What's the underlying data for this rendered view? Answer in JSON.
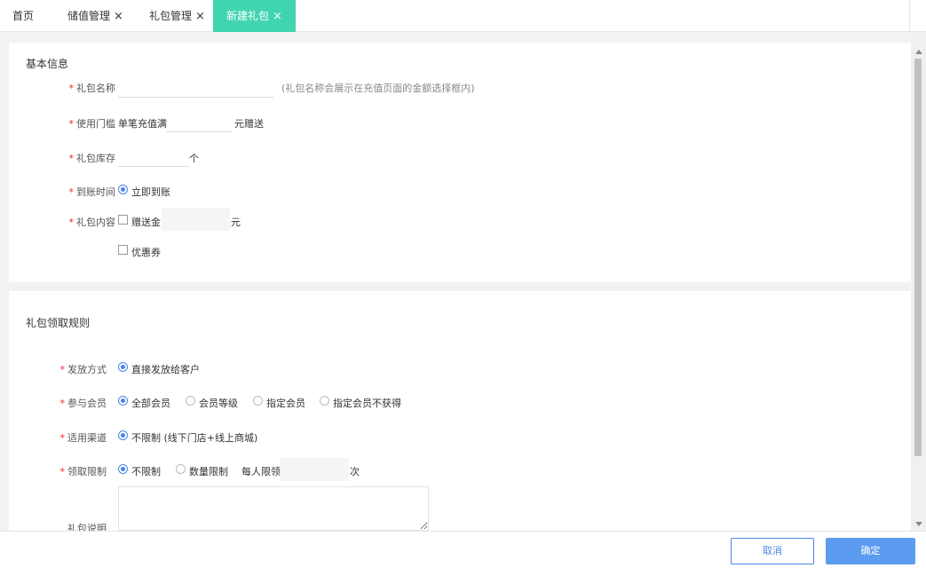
{
  "tabs": [
    {
      "label": "首页",
      "closable": false
    },
    {
      "label": "储值管理",
      "closable": true
    },
    {
      "label": "礼包管理",
      "closable": true
    },
    {
      "label": "新建礼包",
      "closable": true,
      "active": true
    }
  ],
  "close_glyph": "×",
  "required_mark": "*",
  "basic": {
    "title": "基本信息",
    "name": {
      "label": "礼包名称",
      "value": "",
      "hint": "(礼包名称会展示在充值页面的金额选择框内)"
    },
    "threshold": {
      "label": "使用门槛",
      "prefix": "单笔充值满",
      "value": "",
      "suffix": "元赠送"
    },
    "stock": {
      "label": "礼包库存",
      "value": "",
      "unit": "个"
    },
    "arrival": {
      "label": "到账时间",
      "option": "立即到账",
      "selected": true
    },
    "content": {
      "label": "礼包内容",
      "bonus": {
        "label": "赠送金",
        "checked": false,
        "value": "",
        "unit": "元"
      },
      "coupon": {
        "label": "优惠券",
        "checked": false
      }
    }
  },
  "rules": {
    "title": "礼包领取规则",
    "issue": {
      "label": "发放方式",
      "options": [
        "直接发放给客户"
      ],
      "selected": 0
    },
    "members": {
      "label": "参与会员",
      "options": [
        "全部会员",
        "会员等级",
        "指定会员",
        "指定会员不获得"
      ],
      "selected": 0
    },
    "channel": {
      "label": "适用渠道",
      "options": [
        "不限制 (线下门店+线上商城)"
      ],
      "selected": 0
    },
    "limit": {
      "label": "领取限制",
      "options": [
        "不限制",
        "数量限制"
      ],
      "selected": 0,
      "per_person": "每人限领",
      "value": "",
      "unit": "次"
    },
    "desc": {
      "label": "礼包说明",
      "value": ""
    }
  },
  "footer": {
    "cancel": "取消",
    "confirm": "确定"
  },
  "colors": {
    "accent_tab": "#40d5b0",
    "primary": "#5b9cf0",
    "required": "#f5222d",
    "radio": "#4a86e8"
  }
}
